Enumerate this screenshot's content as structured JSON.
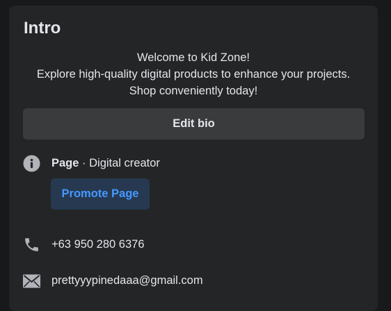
{
  "intro": {
    "title": "Intro",
    "bio_lines": [
      "Welcome to Kid Zone!",
      "Explore high-quality digital products to enhance your projects.",
      "Shop conveniently today!"
    ],
    "edit_bio_label": "Edit bio"
  },
  "page_info": {
    "icon": "info-icon",
    "page_label": "Page",
    "separator": " · ",
    "category": "Digital creator",
    "promote_label": "Promote Page"
  },
  "contact": {
    "phone_icon": "phone-icon",
    "phone": "+63 950 280 6376",
    "email_icon": "email-icon",
    "email": "prettyyypinedaaa@gmail.com"
  },
  "colors": {
    "background": "#18191a",
    "card": "#242526",
    "button": "#3a3b3c",
    "promote_bg": "#263951",
    "promote_text": "#4599ff",
    "text": "#e4e6eb",
    "icon": "#b0b3b8"
  }
}
